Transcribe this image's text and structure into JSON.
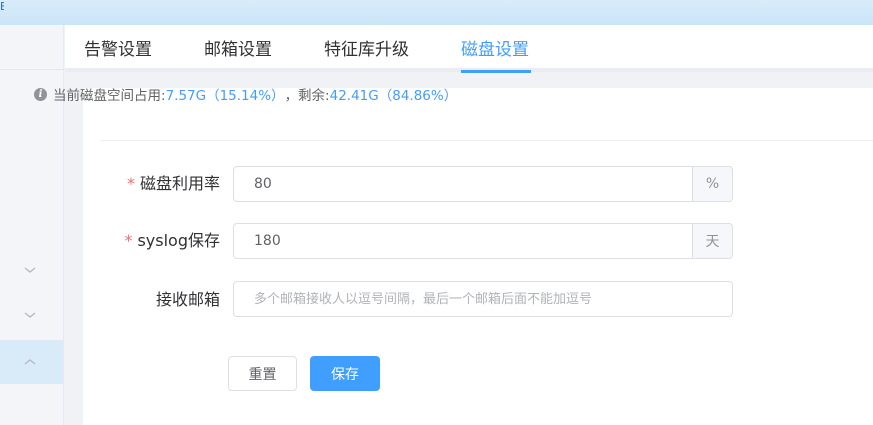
{
  "topbar": {
    "edge_text": "E"
  },
  "sidebar": {
    "items": [
      {
        "name": "menu-group-1",
        "icon": "chevron-down-icon",
        "active": false
      },
      {
        "name": "menu-group-2",
        "icon": "chevron-down-icon",
        "active": false
      },
      {
        "name": "menu-group-3",
        "icon": "chevron-up-icon",
        "active": true
      }
    ]
  },
  "tabs": [
    {
      "label": "告警设置",
      "active": false
    },
    {
      "label": "邮箱设置",
      "active": false
    },
    {
      "label": "特征库升级",
      "active": false
    },
    {
      "label": "磁盘设置",
      "active": true
    }
  ],
  "info": {
    "icon": "info-circle-icon",
    "prefix": "当前磁盘空间占用:",
    "used": "7.57G（15.14%）",
    "sep": "，剩余:",
    "remaining": "42.41G（84.86%）"
  },
  "form": {
    "disk_usage": {
      "label": "磁盘利用率",
      "required_mark": "*",
      "value": "80",
      "unit": "%"
    },
    "syslog": {
      "label": "syslog保存",
      "required_mark": "*",
      "value": "180",
      "unit": "天"
    },
    "emails": {
      "label": "接收邮箱",
      "value": "",
      "placeholder": "多个邮箱接收人以逗号间隔，最后一个邮箱后面不能加逗号"
    }
  },
  "buttons": {
    "reset": "重置",
    "save": "保存"
  },
  "colors": {
    "accent": "#409eff",
    "required": "#f56c6c",
    "sidebar_active": "#d9ebf9",
    "topbar": "#d8ecfa"
  }
}
